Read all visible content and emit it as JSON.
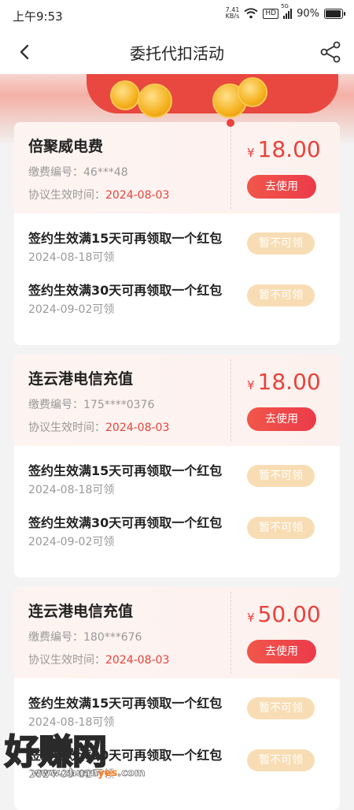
{
  "status_bar": {
    "time": "上午9:53",
    "net_speed_value": "7.41",
    "net_speed_unit": "KB/s",
    "hd": "HD",
    "signal_label": "5G",
    "battery": "90%"
  },
  "nav": {
    "title": "委托代扣活动"
  },
  "cards": [
    {
      "name": "倍聚威电费",
      "number_label": "缴费编号：",
      "number": "46***48",
      "effective_label": "协议生效时间：",
      "effective_date": "2024-08-03",
      "currency": "¥",
      "amount": "18.00",
      "use_label": "去使用",
      "rewards": [
        {
          "title": "签约生效满15天可再领取一个红包",
          "date": "2024-08-18可领",
          "button": "暂不可领"
        },
        {
          "title": "签约生效满30天可再领取一个红包",
          "date": "2024-09-02可领",
          "button": "暂不可领"
        }
      ]
    },
    {
      "name": "连云港电信充值",
      "number_label": "缴费编号：",
      "number": "175****0376",
      "effective_label": "协议生效时间：",
      "effective_date": "2024-08-03",
      "currency": "¥",
      "amount": "18.00",
      "use_label": "去使用",
      "rewards": [
        {
          "title": "签约生效满15天可再领取一个红包",
          "date": "2024-08-18可领",
          "button": "暂不可领"
        },
        {
          "title": "签约生效满30天可再领取一个红包",
          "date": "2024-09-02可领",
          "button": "暂不可领"
        }
      ]
    },
    {
      "name": "连云港电信充值",
      "number_label": "缴费编号：",
      "number": "180***676",
      "effective_label": "协议生效时间：",
      "effective_date": "2024-08-03",
      "currency": "¥",
      "amount": "50.00",
      "use_label": "去使用",
      "rewards": [
        {
          "title": "签约生效满15天可再领取一个红包",
          "date": "2024-08-18可领",
          "button": "暂不可领"
        },
        {
          "title": "签约生效满30天可再领取一个红包",
          "date": "2024-09-02可领",
          "button": "暂不可领"
        }
      ]
    }
  ],
  "watermark": {
    "text": "好赚网",
    "url_prefix": "www.zhuan",
    "url_highlight": "yes",
    "url_suffix": ".com"
  },
  "colors": {
    "accent": "#e9423b",
    "claim_disabled": "#f8ddb4",
    "page_bg": "#f3f3f3"
  },
  "icons": {
    "back": "chevron-left-icon",
    "share": "share-icon"
  }
}
